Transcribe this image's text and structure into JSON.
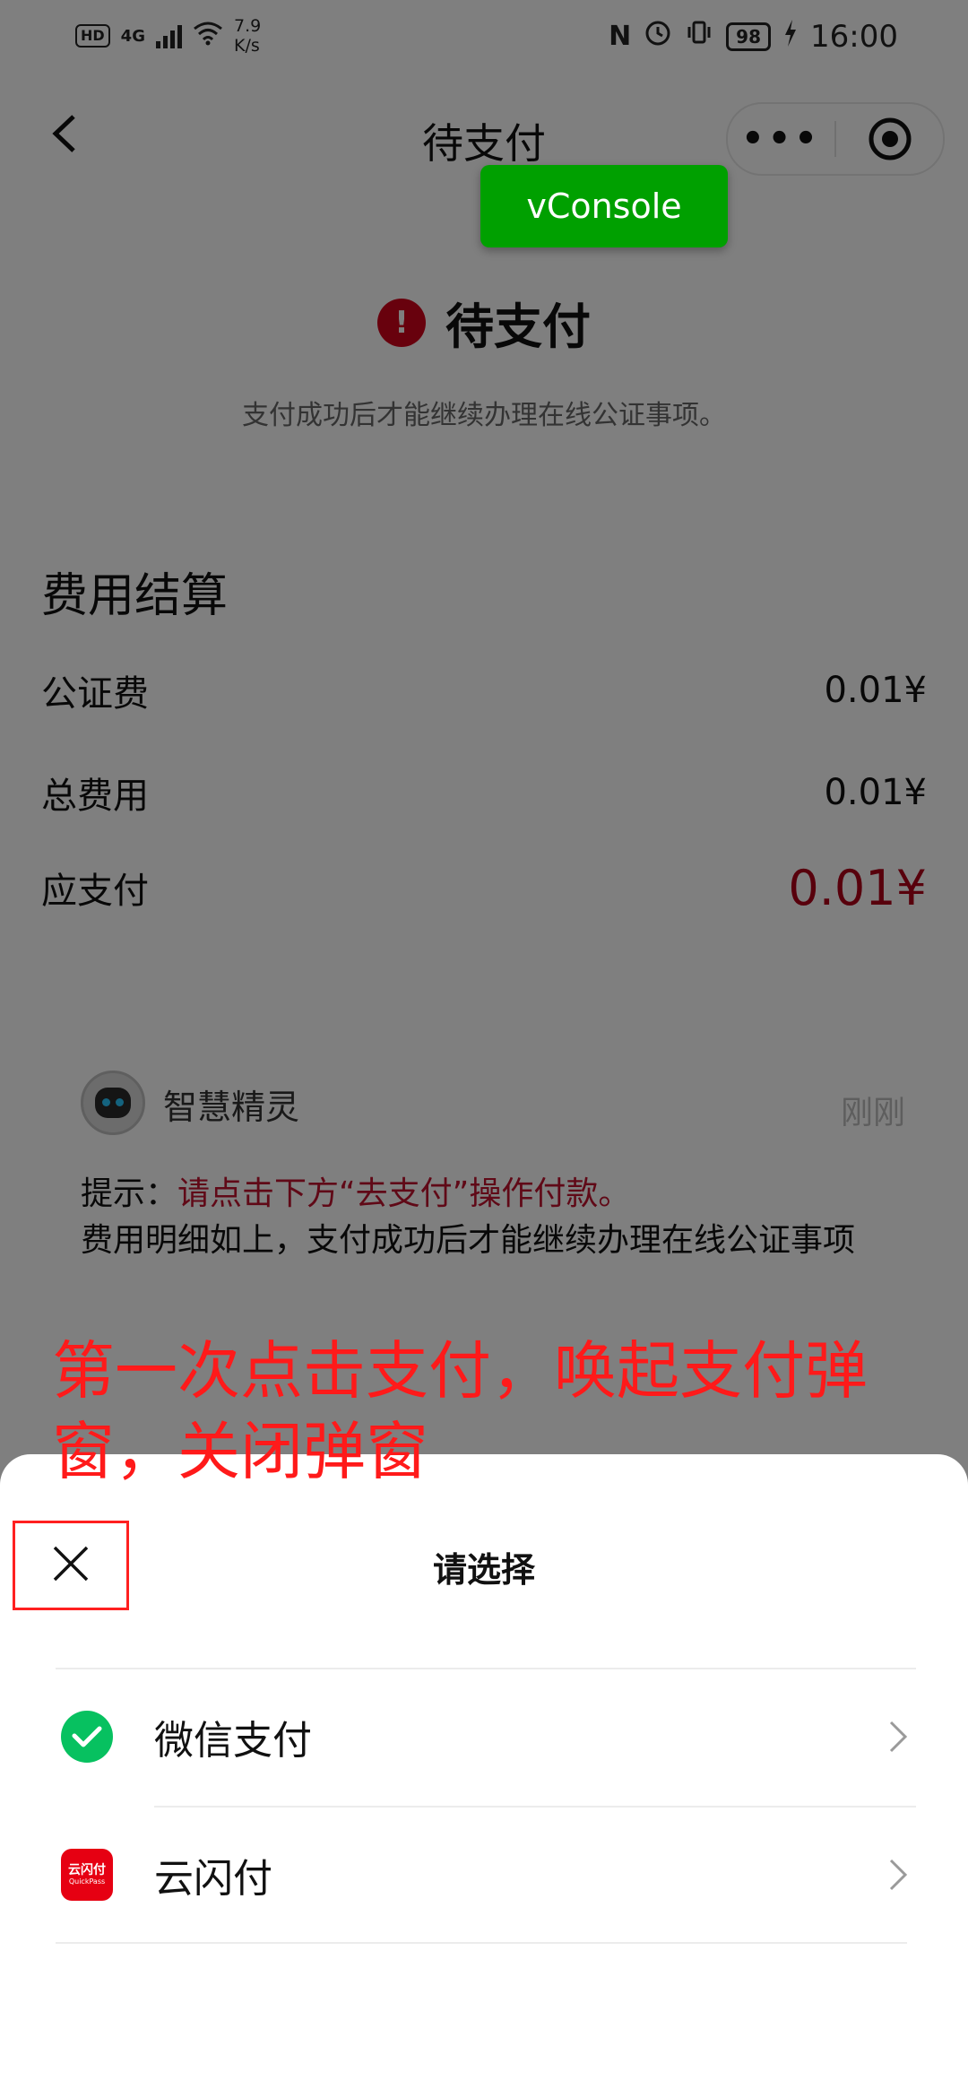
{
  "status_bar": {
    "hd": "HD",
    "network": "4G",
    "speed_value": "7.9",
    "speed_unit": "K/s",
    "nfc": "N",
    "battery": "98",
    "time": "16:00"
  },
  "nav": {
    "title": "待支付",
    "more_label": "•••"
  },
  "debug_button": {
    "label": "vConsole",
    "color": "#00a000"
  },
  "status_card": {
    "icon": "!",
    "title": "待支付",
    "description": "支付成功后才能继续办理在线公证事项。"
  },
  "fee": {
    "title": "费用结算",
    "rows": [
      {
        "label": "公证费",
        "value": "0.01¥"
      },
      {
        "label": "总费用",
        "value": "0.01¥"
      },
      {
        "label": "应支付",
        "value": "0.01¥"
      }
    ]
  },
  "chat": {
    "bot_name": "智慧精灵",
    "time": "刚刚",
    "hint_prefix": "提示：",
    "hint_text": "请点击下方“去支付”操作付款。",
    "body": "费用明细如上，支付成功后才能继续办理在线公证事项"
  },
  "annotation": {
    "text": "第一次点击支付，唤起支付弹窗，关闭弹窗",
    "color": "#ff1a1a"
  },
  "sheet": {
    "title": "请选择",
    "close_icon": "close-icon",
    "options": [
      {
        "label": "微信支付",
        "icon": "wechat-pay-icon",
        "color": "#07c160"
      },
      {
        "label": "云闪付",
        "icon": "unionpay-quickpass-icon",
        "icon_text": "云闪付",
        "icon_subtext": "QuickPass",
        "color": "#e60012"
      }
    ]
  }
}
